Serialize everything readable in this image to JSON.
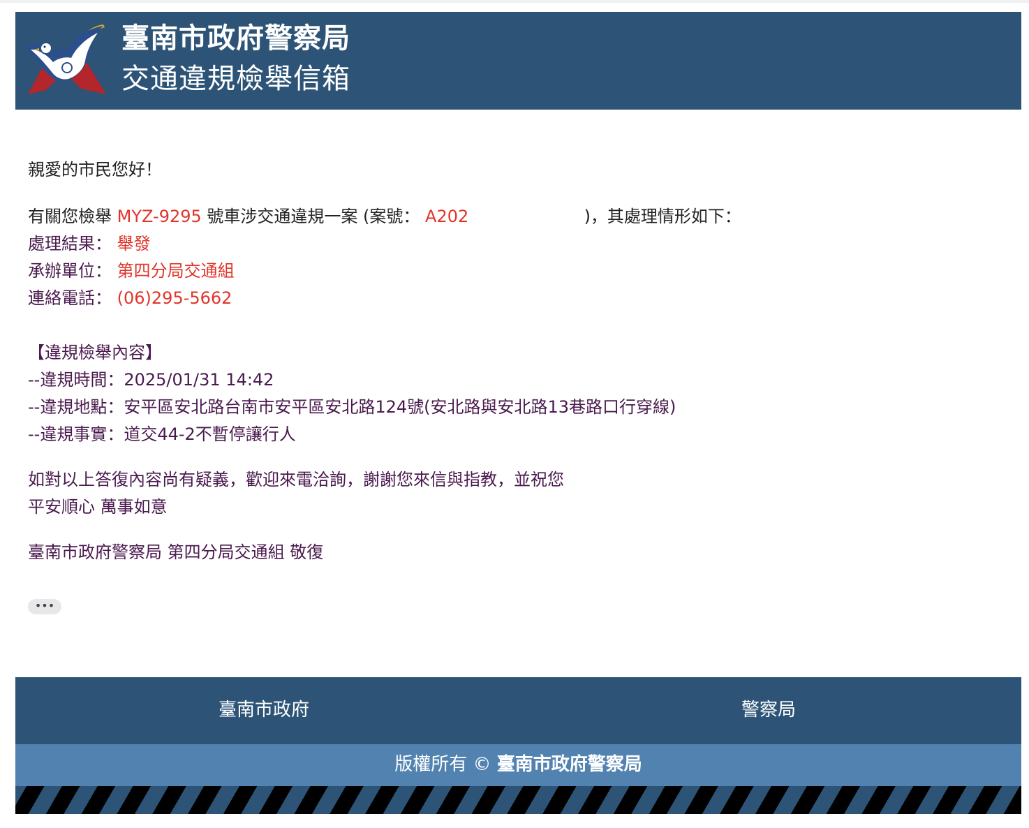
{
  "header": {
    "title_line1": "臺南市政府警察局",
    "title_line2": "交通違規檢舉信箱",
    "logo_icon": "police-dove-emblem-icon"
  },
  "letter": {
    "greeting": "親愛的市民您好！",
    "intro_prefix": "有關您檢舉",
    "plate": "MYZ-9295",
    "intro_middle": "號車涉交通違規一案 (案號：",
    "case_no": "A202",
    "intro_suffix": ")，其處理情形如下：",
    "result_label": "處理結果：",
    "result_value": "舉發",
    "unit_label": "承辦單位：",
    "unit_value": "第四分局交通組",
    "phone_label": "連絡電話：",
    "phone_value": "(06)295-5662",
    "section_title": "【違規檢舉內容】",
    "time_label": "--違規時間：",
    "time_value": "2025/01/31 14:42",
    "place_label": "--違規地點：",
    "place_value": "安平區安北路台南市安平區安北路124號(安北路與安北路13巷路口行穿線)",
    "fact_label": "--違規事實：",
    "fact_value": "道交44-2不暫停讓行人",
    "closing1": "如對以上答復內容尚有疑義，歡迎來電洽詢，謝謝您來信與指教，並祝您",
    "closing2": "平安順心 萬事如意",
    "signature": "臺南市政府警察局 第四分局交通組 敬復",
    "more_label": "•••"
  },
  "footer": {
    "link_city": "臺南市政府",
    "link_police": "警察局",
    "copyright_prefix": "版權所有 © ",
    "copyright_org": "臺南市政府警察局"
  },
  "colors": {
    "header_bg": "#2d5477",
    "copyright_bg": "#5283b0",
    "highlight_red": "#e0352b",
    "text_purple": "#4a1a4e"
  }
}
